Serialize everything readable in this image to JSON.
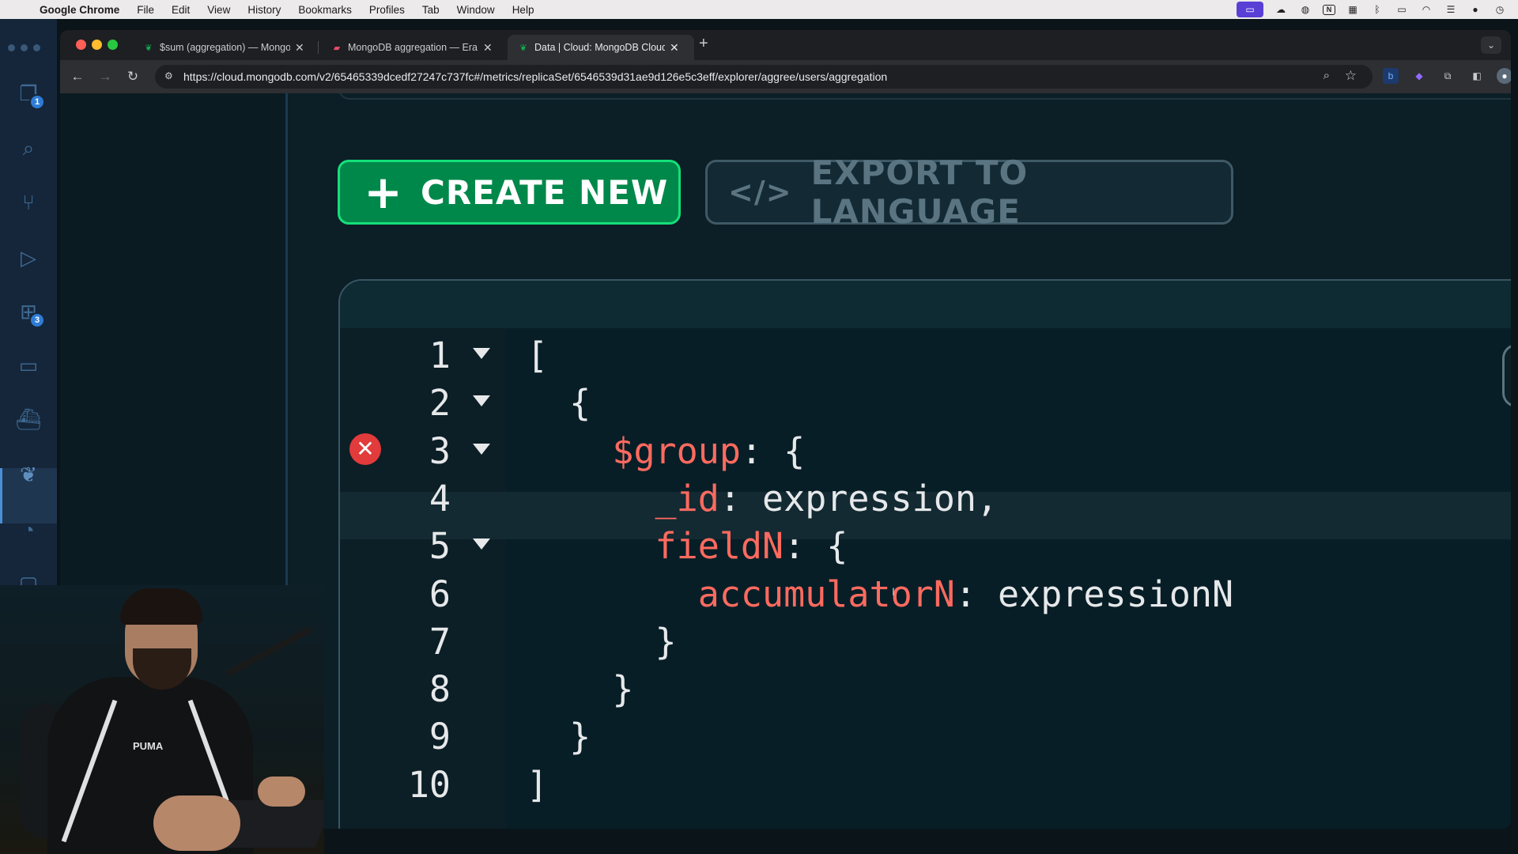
{
  "menubar": {
    "app": "Google Chrome",
    "items": [
      "File",
      "Edit",
      "View",
      "History",
      "Bookmarks",
      "Profiles",
      "Tab",
      "Window",
      "Help"
    ],
    "status_icons": [
      "screen-share-icon",
      "cloud-icon",
      "wifi-alt-icon",
      "notion-icon",
      "grid-icon",
      "bluetooth-icon",
      "display-icon",
      "wifi-icon",
      "control-center-icon",
      "siri-icon",
      "clock-icon"
    ]
  },
  "activity_bar": {
    "badges": {
      "explorer": "1",
      "extensions": "3"
    },
    "icons": [
      "files-icon",
      "search-icon",
      "source-control-icon",
      "run-debug-icon",
      "extensions-icon",
      "remote-explorer-icon",
      "docker-icon",
      "mongodb-leaf-icon",
      "testing-icon",
      "comments-icon",
      "account-icon",
      "settings-gear-icon"
    ]
  },
  "browser": {
    "tabs": [
      {
        "title": "$sum (aggregation) — Mongo",
        "favicon": "mongodb-leaf-icon",
        "color": "#13aa52"
      },
      {
        "title": "MongoDB aggregation — Era",
        "favicon": "eraser-icon",
        "color": "#e94b6a"
      },
      {
        "title": "Data | Cloud: MongoDB Cloud",
        "favicon": "mongodb-leaf-icon",
        "color": "#13aa52"
      }
    ],
    "active_tab": 2,
    "url": "https://cloud.mongodb.com/v2/65465339dcedf27247c737fc#/metrics/replicaSet/6546539d31ae9d126e5c3eff/explorer/aggree/users/aggregation"
  },
  "page": {
    "create_label": "CREATE NEW",
    "export_label": "EXPORT TO LANGUAGE",
    "editor": {
      "line_numbers": [
        "1",
        "2",
        "3",
        "4",
        "5",
        "6",
        "7",
        "8",
        "9",
        "10"
      ],
      "lines": [
        [
          {
            "t": "[",
            "c": "pun"
          }
        ],
        [
          {
            "t": "  {",
            "c": "pun"
          }
        ],
        [
          {
            "t": "    $group",
            "c": "key"
          },
          {
            "t": ": {",
            "c": "pun"
          }
        ],
        [
          {
            "t": "      _id",
            "c": "key"
          },
          {
            "t": ": expression,",
            "c": "val"
          }
        ],
        [
          {
            "t": "      fieldN",
            "c": "key"
          },
          {
            "t": ": {",
            "c": "pun"
          }
        ],
        [
          {
            "t": "        accumulatorN",
            "c": "key"
          },
          {
            "t": ": expressionN",
            "c": "val"
          }
        ],
        [
          {
            "t": "      }",
            "c": "pun"
          }
        ],
        [
          {
            "t": "    }",
            "c": "pun"
          }
        ],
        [
          {
            "t": "  }",
            "c": "pun"
          }
        ],
        [
          {
            "t": "]",
            "c": "pun"
          }
        ]
      ],
      "foldable_lines": [
        1,
        2,
        3,
        5
      ],
      "error_line": 3,
      "current_line": 4
    }
  },
  "colors": {
    "create_bg": "#00884a",
    "create_border": "#14e07a",
    "key": "#ff6a5f",
    "error": "#e23b3b",
    "editor_bg": "#071e27"
  }
}
